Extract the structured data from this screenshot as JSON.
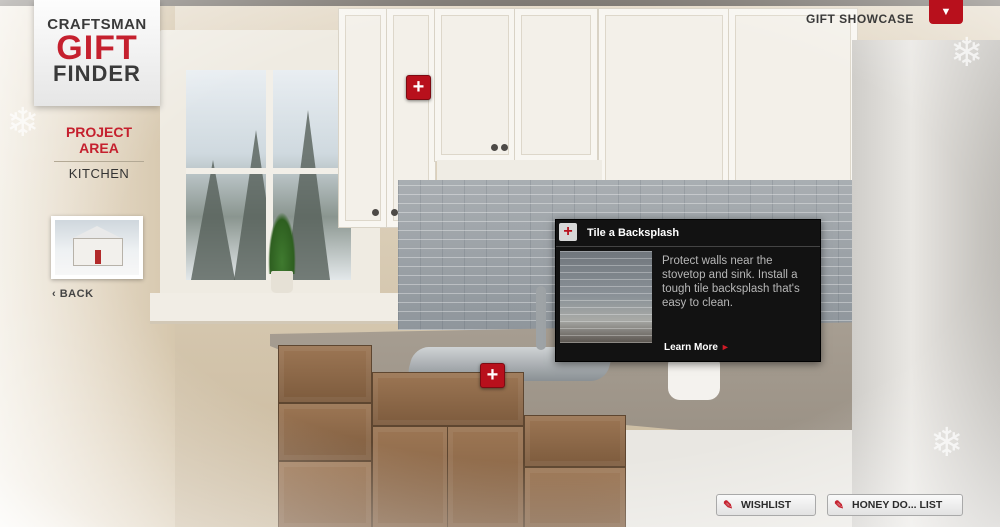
{
  "logo": {
    "line1": "CRAFTSMAN",
    "line2": "GIFT",
    "line3": "FINDER"
  },
  "project_area": {
    "title": "PROJECT AREA",
    "value": "KITCHEN"
  },
  "back_label": "BACK",
  "header": {
    "showcase_label": "GIFT SHOWCASE",
    "dropdown_icon": "chevron-down-icon"
  },
  "hotspots": [
    {
      "symbol": "+",
      "label": "hotspot-cabinets"
    },
    {
      "symbol": "+",
      "label": "hotspot-sink"
    }
  ],
  "popup": {
    "plus": "+",
    "title": "Tile a Backsplash",
    "body": "Protect walls near the stovetop and sink. Install a tough tile backsplash that's easy to clean.",
    "link": "Learn More",
    "link_arrow": "►"
  },
  "footer": {
    "wishlist": "WISHLIST",
    "honey_do": "HONEY DO... LIST",
    "icon": "pencil-icon"
  },
  "colors": {
    "brand_red": "#c5202e",
    "button_red": "#b8101c",
    "popup_bg": "#121212"
  }
}
